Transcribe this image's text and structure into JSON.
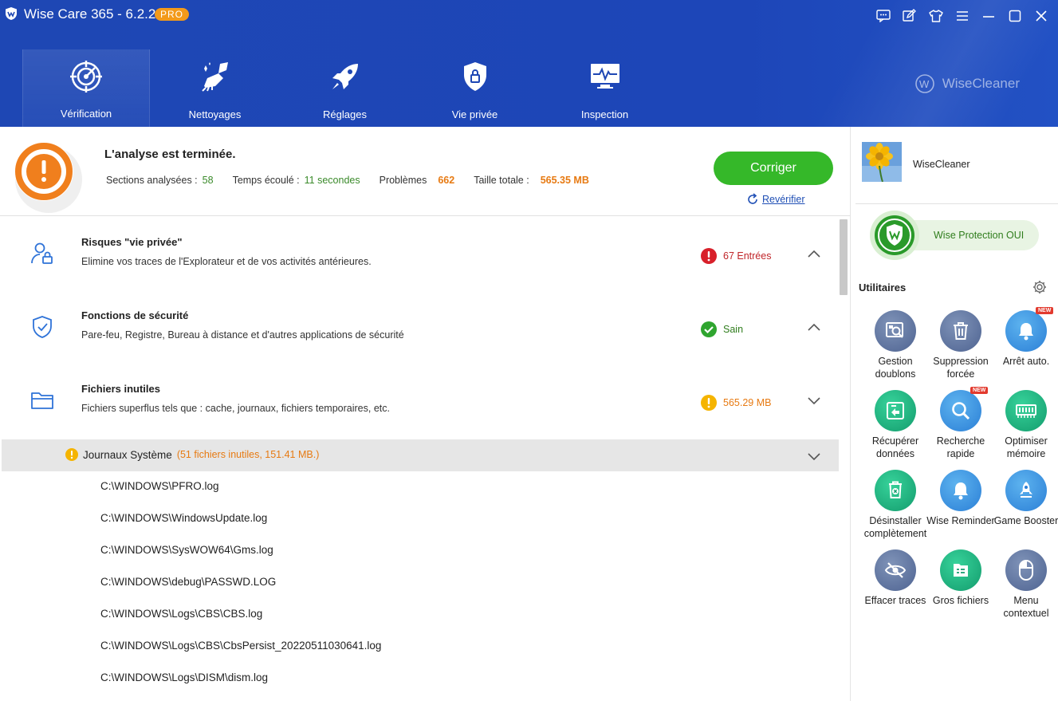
{
  "app": {
    "title": "Wise Care 365 - 6.2.2",
    "badge": "PRO",
    "brand": "WiseCleaner"
  },
  "window_controls": [
    "feedback-icon",
    "edit-icon",
    "skin-icon",
    "menu-icon",
    "minimize-icon",
    "maximize-icon",
    "close-icon"
  ],
  "nav": [
    {
      "label": "Vérification",
      "icon": "radar-icon",
      "active": true
    },
    {
      "label": "Nettoyages",
      "icon": "broom-icon",
      "active": false
    },
    {
      "label": "Réglages",
      "icon": "rocket-icon",
      "active": false
    },
    {
      "label": "Vie privée",
      "icon": "shield-lock-icon",
      "active": false
    },
    {
      "label": "Inspection",
      "icon": "monitor-pulse-icon",
      "active": false
    }
  ],
  "summary": {
    "title": "L'analyse est terminée.",
    "sections_label": "Sections analysées :",
    "sections_value": "58",
    "elapsed_label": "Temps écoulé :",
    "elapsed_value": "11 secondes",
    "problems_label": "Problèmes",
    "problems_value": "662",
    "total_label": "Taille totale :",
    "total_value": "565.35 MB",
    "fix_button": "Corriger",
    "recheck": "Revérifier"
  },
  "categories": [
    {
      "title": "Risques \"vie privée\"",
      "description": "Elimine vos traces de l'Explorateur et de vos activités antérieures.",
      "status": "67 Entrées",
      "status_type": "error",
      "expanded": true
    },
    {
      "title": "Fonctions de sécurité",
      "description": "Pare-feu, Registre, Bureau à distance et d'autres applications de sécurité",
      "status": "Sain",
      "status_type": "ok",
      "expanded": true
    },
    {
      "title": "Fichiers inutiles",
      "description": "Fichiers superflus tels que : cache, journaux, fichiers temporaires, etc.",
      "status": "565.29 MB",
      "status_type": "warn",
      "expanded": false
    }
  ],
  "subgroup": {
    "title": "Journaux Système",
    "count": "(51 fichiers inutiles, 151.41 MB.)"
  },
  "files": [
    "C:\\WINDOWS\\PFRO.log",
    "C:\\WINDOWS\\WindowsUpdate.log",
    "C:\\WINDOWS\\SysWOW64\\Gms.log",
    "C:\\WINDOWS\\debug\\PASSWD.LOG",
    "C:\\WINDOWS\\Logs\\CBS\\CBS.log",
    "C:\\WINDOWS\\Logs\\CBS\\CbsPersist_20220511030641.log",
    "C:\\WINDOWS\\Logs\\DISM\\dism.log"
  ],
  "right_panel": {
    "user": "WiseCleaner",
    "protection": "Wise Protection OUI",
    "utilities_title": "Utilitaires",
    "tools": [
      {
        "label": "Gestion doublons",
        "icon": "duplicate-finder-icon",
        "color": "slate",
        "new": false
      },
      {
        "label": "Suppression forcée",
        "icon": "trash-icon",
        "color": "slate",
        "new": false
      },
      {
        "label": "Arrêt auto.",
        "icon": "bell-icon",
        "color": "blue",
        "new": true
      },
      {
        "label": "Récupérer données",
        "icon": "data-recovery-icon",
        "color": "green",
        "new": false
      },
      {
        "label": "Recherche rapide",
        "icon": "magnifier-icon",
        "color": "blue",
        "new": true
      },
      {
        "label": "Optimiser mémoire",
        "icon": "memory-chip-icon",
        "color": "green",
        "new": false
      },
      {
        "label": "Désinstaller complètement",
        "icon": "uninstall-icon",
        "color": "green",
        "new": false
      },
      {
        "label": "Wise Reminder",
        "icon": "reminder-bell-icon",
        "color": "blue",
        "new": false
      },
      {
        "label": "Game Booster",
        "icon": "game-rocket-icon",
        "color": "blue",
        "new": false
      },
      {
        "label": "Effacer traces",
        "icon": "eye-off-icon",
        "color": "slate",
        "new": false
      },
      {
        "label": "Gros fichiers",
        "icon": "big-files-icon",
        "color": "green",
        "new": false
      },
      {
        "label": "Menu contextuel",
        "icon": "mouse-icon",
        "color": "slate",
        "new": false
      }
    ],
    "new_badge": "NEW"
  },
  "colors": {
    "header": "#1e47b4",
    "accent_green": "#35b829",
    "warn_orange": "#e77a12",
    "error_red": "#d8202a",
    "ok_green": "#2fa52f"
  }
}
